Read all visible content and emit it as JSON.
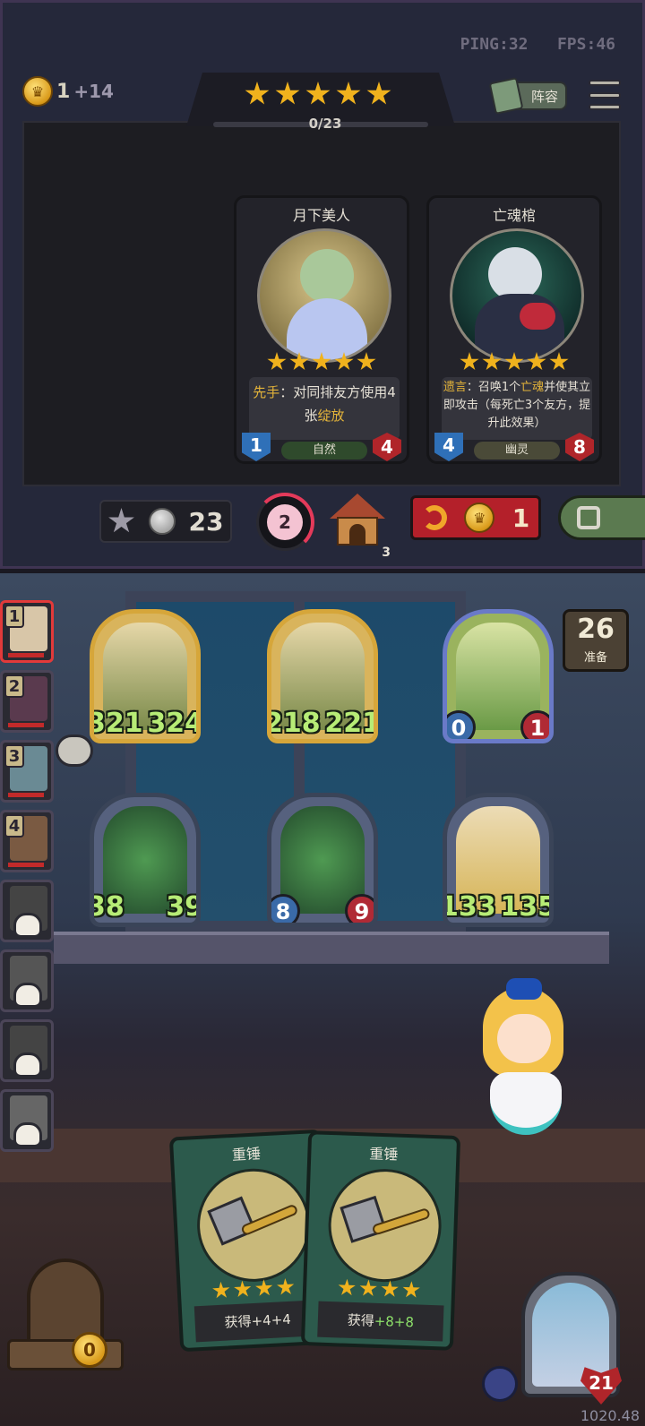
{
  "hud": {
    "ping": "PING:32",
    "fps": "FPS:46",
    "gold": "1",
    "gold_income": "+14",
    "lineup_label": "阵容",
    "tier_stars": 5,
    "tier_progress": "0/23",
    "tier_progress_fraction": 0
  },
  "shop": {
    "cards": [
      {
        "name": "月下美人",
        "stars": 5,
        "desc_lead": "先手",
        "desc_body": "：对同排友方使用4张",
        "desc_hl": "绽放",
        "attack": "1",
        "health": "4",
        "tribe": "自然"
      },
      {
        "name": "亡魂棺",
        "stars": 5,
        "desc_lead": "遗言",
        "desc_body": "：召唤1个",
        "desc_hl": "亡魂",
        "desc_tail": "并使其立即攻击（每死亡3个友方，提升此效果）",
        "attack": "4",
        "health": "8",
        "tribe": "幽灵"
      }
    ],
    "upgrade_cost": "23",
    "flower_count": "2",
    "house_count": "3",
    "refresh_cost": "1"
  },
  "players": [
    {
      "rank": "1",
      "active": true,
      "eliminated": false,
      "color": "#d8c6a8"
    },
    {
      "rank": "2",
      "active": false,
      "eliminated": false,
      "color": "#5a3a4e"
    },
    {
      "rank": "3",
      "active": false,
      "eliminated": false,
      "color": "#6a8a94"
    },
    {
      "rank": "4",
      "active": false,
      "eliminated": false,
      "color": "#7a5a42"
    },
    {
      "rank": "",
      "active": false,
      "eliminated": true,
      "color": "#444"
    },
    {
      "rank": "",
      "active": false,
      "eliminated": true,
      "color": "#555"
    },
    {
      "rank": "",
      "active": false,
      "eliminated": true,
      "color": "#444"
    },
    {
      "rank": "",
      "active": false,
      "eliminated": true,
      "color": "#666"
    }
  ],
  "ready": {
    "count": "26",
    "label": "准备"
  },
  "board": {
    "front": [
      {
        "attack": "321",
        "health": "324",
        "frame": "gold",
        "style": "text"
      },
      {
        "attack": "218",
        "health": "221",
        "frame": "gold",
        "style": "text"
      },
      {
        "attack": "0",
        "health": "1",
        "frame": "blue",
        "style": "badge"
      }
    ],
    "back": [
      {
        "attack": "38",
        "health": "39",
        "frame": "dark",
        "style": "text"
      },
      {
        "attack": "8",
        "health": "9",
        "frame": "dark",
        "style": "badge"
      },
      {
        "attack": "133",
        "health": "135",
        "frame": "dark",
        "style": "text"
      }
    ]
  },
  "hand": [
    {
      "name": "重锤",
      "stars": 4,
      "desc_prefix": "获得",
      "desc_value": "+4+4"
    },
    {
      "name": "重锤",
      "stars": 4,
      "desc_prefix": "获得",
      "desc_value": "+8+8"
    }
  ],
  "bench_gold": "0",
  "player_health": "21",
  "version": "1020.48",
  "colors": {
    "star": "#f0b21d",
    "attack_blue": "#2f70b8",
    "health_red": "#b0252a",
    "stat_green": "#b7ec76"
  },
  "icons": [
    "coin-icon",
    "book-icon",
    "menu-icon",
    "star-icon",
    "silver-coin-icon",
    "flower-icon",
    "house-icon",
    "refresh-arrow-icon",
    "lock-icon",
    "skull-icon",
    "chat-icon",
    "hammer-icon",
    "shield-icon",
    "heart-icon"
  ]
}
